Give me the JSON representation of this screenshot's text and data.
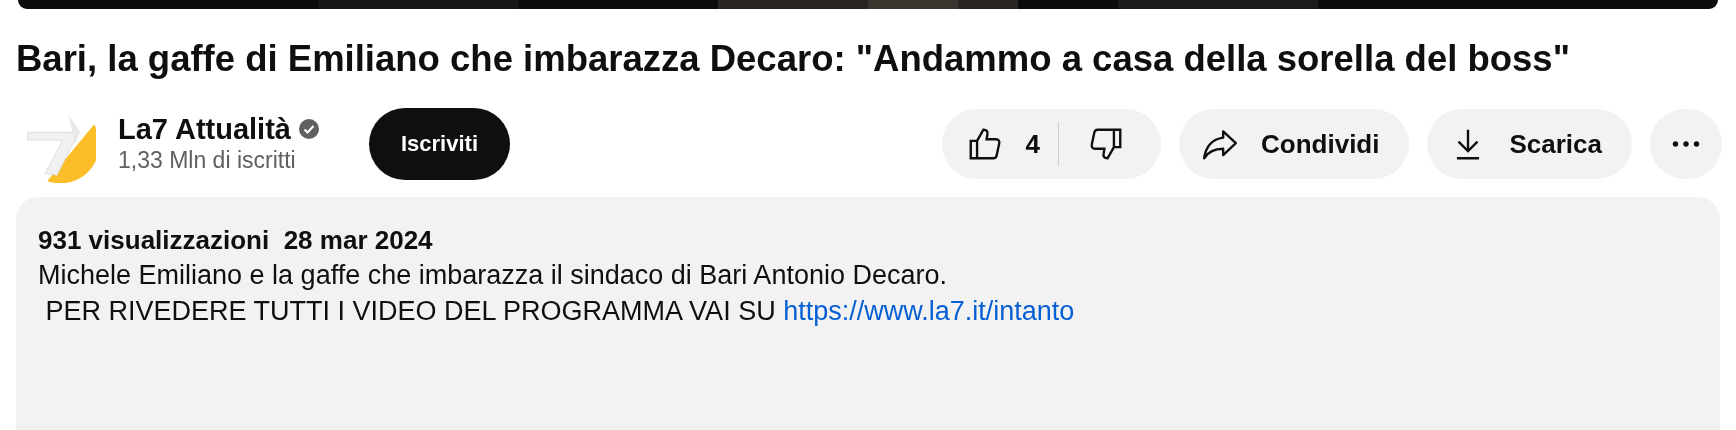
{
  "title": "Bari, la gaffe di Emiliano che imbarazza Decaro: \"Andammo a casa della sorella del boss\"",
  "channel": {
    "name": "La7 Attualità",
    "verified": true,
    "subscribers": "1,33 Mln di iscritti",
    "subscribe_label": "Iscriviti"
  },
  "actions": {
    "likes": "4",
    "share": "Condividi",
    "download": "Scarica"
  },
  "description": {
    "meta": "931 visualizzazioni  28 mar 2024",
    "line_1": "Michele Emiliano e la gaffe che imbarazza il sindaco di Bari Antonio Decaro.",
    "line_2": " PER RIVEDERE TUTTI I VIDEO DEL PROGRAMMA VAI SU ",
    "link": "https://www.la7.it/intanto"
  }
}
